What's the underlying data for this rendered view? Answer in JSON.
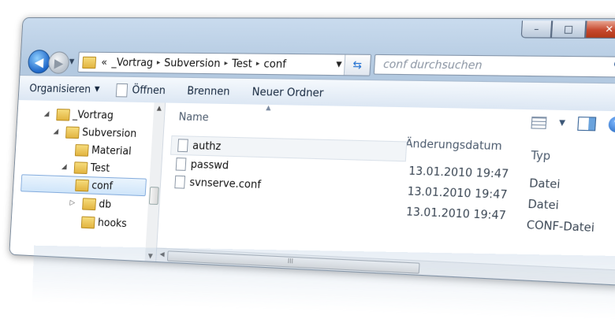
{
  "address": {
    "overflow": "«",
    "segments": [
      "_Vortrag",
      "Subversion",
      "Test",
      "conf"
    ],
    "separator": "▸"
  },
  "search": {
    "placeholder": "conf durchsuchen"
  },
  "toolbar": {
    "organize_label": "Organisieren",
    "open_label": "Öffnen",
    "burn_label": "Brennen",
    "new_folder_label": "Neuer Ordner"
  },
  "tree": {
    "items": [
      {
        "label": "_Vortrag",
        "expanded": true
      },
      {
        "label": "Subversion",
        "expanded": true
      },
      {
        "label": "Material"
      },
      {
        "label": "Test",
        "expanded": true
      },
      {
        "label": "conf",
        "selected": true
      },
      {
        "label": "db",
        "collapsed": true
      },
      {
        "label": "hooks"
      }
    ]
  },
  "list": {
    "col_name": "Name",
    "col_modified": "Änderungsdatum",
    "col_type": "Typ",
    "files": [
      {
        "name": "authz",
        "modified": "13.01.2010 19:47",
        "type": "Datei"
      },
      {
        "name": "passwd",
        "modified": "13.01.2010 19:47",
        "type": "Datei"
      },
      {
        "name": "svnserve.conf",
        "modified": "13.01.2010 19:47",
        "type": "CONF-Datei"
      }
    ]
  },
  "scroll": {
    "grip": "III"
  },
  "icons": {
    "back": "back-arrow-icon",
    "forward": "forward-arrow-icon",
    "refresh": "refresh-icon",
    "search": "search-icon",
    "folder": "folder-icon",
    "file": "file-icon",
    "help": "help-icon",
    "views": "views-icon",
    "preview": "preview-pane-icon"
  },
  "colors": {
    "frame": "#b3c9e0",
    "selection": "#cfe5fa",
    "close": "#c6492f"
  }
}
